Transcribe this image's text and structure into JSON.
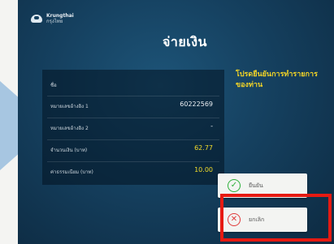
{
  "brand": {
    "name": "Krungthai",
    "sub": "กรุงไทย"
  },
  "page_title": "จ่ายเงิน",
  "details": [
    {
      "label": "ชื่อ",
      "value": ""
    },
    {
      "label": "หมายเลขอ้างอิง 1",
      "value": "60222569"
    },
    {
      "label": "หมายเลขอ้างอิง 2",
      "value": "-"
    },
    {
      "label": "จำนวนเงิน (บาท)",
      "value": "62.77"
    },
    {
      "label": "ค่าธรรมเนียม (บาท)",
      "value": "10.00"
    }
  ],
  "prompt": "โปรดยืนยันการทำรายการของท่าน",
  "buttons": {
    "confirm_label": "ยืนยัน",
    "cancel_label": "ยกเลิก"
  },
  "icons": {
    "confirm": "check-circle-icon",
    "cancel": "x-circle-icon"
  },
  "colors": {
    "accent_yellow": "#f2dc2a",
    "confirm_green": "#2db03a",
    "cancel_red": "#e03a3a",
    "highlight_red": "#e61a12"
  }
}
